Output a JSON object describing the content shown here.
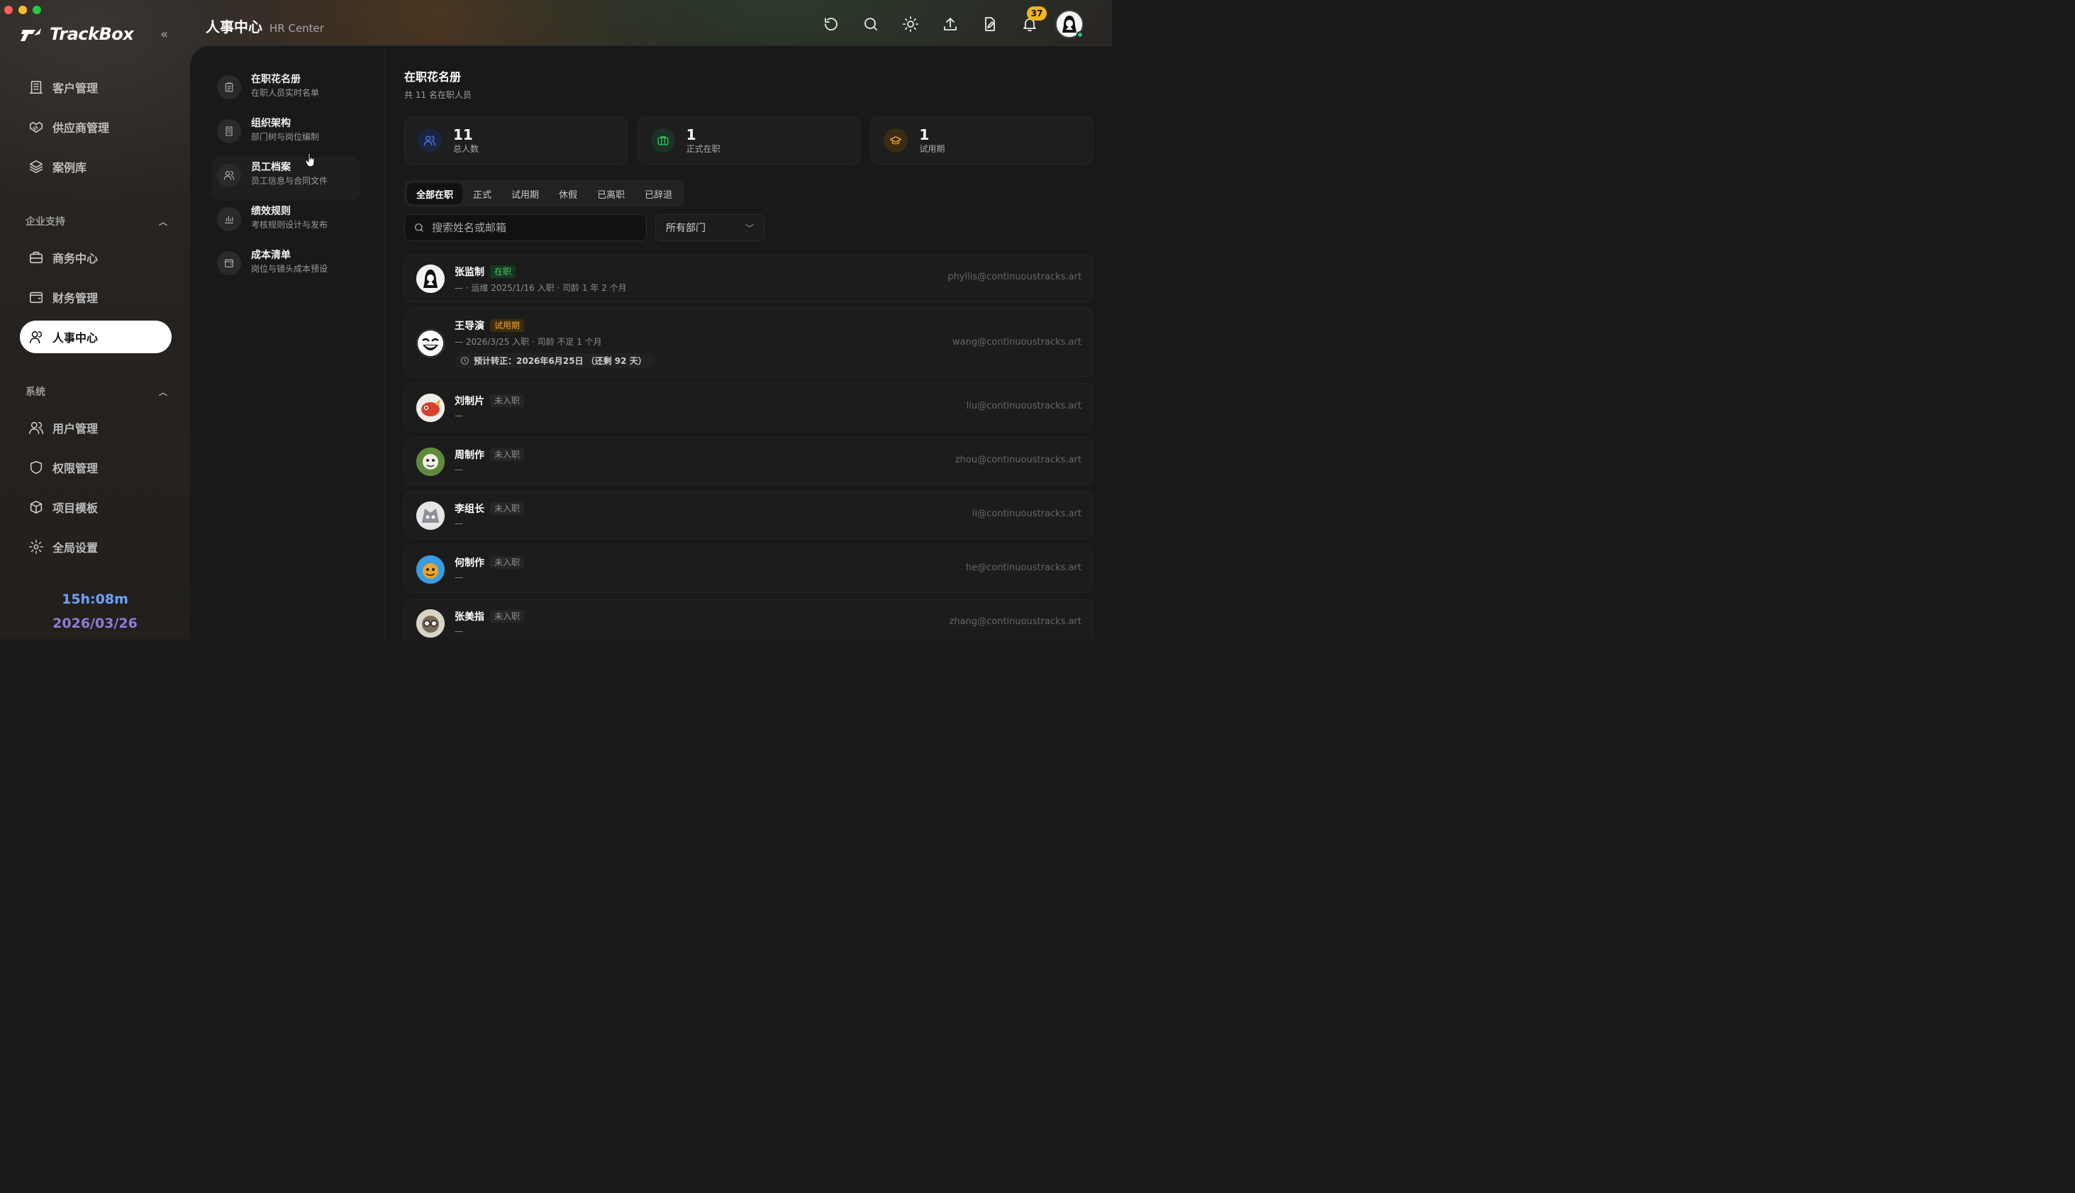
{
  "app": {
    "name": "TrackBox"
  },
  "header": {
    "title": "人事中心",
    "subtitle": "HR Center",
    "notification_count": "37",
    "icons": [
      "refresh-icon",
      "search-icon",
      "sun-icon",
      "upload-icon",
      "edit-file-icon",
      "bell-icon"
    ]
  },
  "sidebar": {
    "items_top": [
      {
        "label": "客户管理",
        "icon": "building-icon"
      },
      {
        "label": "供应商管理",
        "icon": "handshake-icon"
      },
      {
        "label": "案例库",
        "icon": "layers-icon"
      }
    ],
    "section_support": "企业支持",
    "items_support": [
      {
        "label": "商务中心",
        "icon": "briefcase-icon"
      },
      {
        "label": "财务管理",
        "icon": "wallet-icon"
      },
      {
        "label": "人事中心",
        "icon": "user-icon",
        "active": true
      }
    ],
    "section_system": "系统",
    "items_system": [
      {
        "label": "用户管理",
        "icon": "users-icon"
      },
      {
        "label": "权限管理",
        "icon": "shield-icon"
      },
      {
        "label": "项目模板",
        "icon": "cube-icon"
      },
      {
        "label": "全局设置",
        "icon": "gear-icon"
      }
    ],
    "clock": {
      "time": "15h:08m",
      "date": "2026/03/26"
    }
  },
  "subnav": [
    {
      "title": "在职花名册",
      "desc": "在职人员实时名单",
      "icon": "clipboard-icon"
    },
    {
      "title": "组织架构",
      "desc": "部门树与岗位编制",
      "icon": "building-icon"
    },
    {
      "title": "员工档案",
      "desc": "员工信息与合同文件",
      "icon": "users-icon"
    },
    {
      "title": "绩效规则",
      "desc": "考核规则设计与发布",
      "icon": "bar-chart-icon"
    },
    {
      "title": "成本清单",
      "desc": "岗位与镜头成本预设",
      "icon": "wallet-icon"
    }
  ],
  "main": {
    "title": "在职花名册",
    "subtitle": "共 11 名在职人员",
    "stats": [
      {
        "value": "11",
        "label": "总人数",
        "color": "#4f7cff"
      },
      {
        "value": "1",
        "label": "正式在职",
        "color": "#35c45e"
      },
      {
        "value": "1",
        "label": "试用期",
        "color": "#f0a73a"
      }
    ],
    "tabs": [
      "全部在职",
      "正式",
      "试用期",
      "休假",
      "已离职",
      "已辞退"
    ],
    "search_placeholder": "搜索姓名或邮箱",
    "dept_select": "所有部门",
    "people": [
      {
        "name": "张监制",
        "status": "在职",
        "status_type": "on",
        "meta": "— · 运维   2025/1/16 入职   · 司龄 1 年 2 个月",
        "email": "phyllis@continuoustracks.art"
      },
      {
        "name": "王导演",
        "status": "试用期",
        "status_type": "trial",
        "meta": "—   2026/3/25 入职   · 司龄 不足 1 个月",
        "eta": "预计转正：2026年6月25日 （还剩 92 天）",
        "email": "wang@continuoustracks.art"
      },
      {
        "name": "刘制片",
        "status": "未入职",
        "status_type": "none",
        "meta": "—",
        "email": "liu@continuoustracks.art"
      },
      {
        "name": "周制作",
        "status": "未入职",
        "status_type": "none",
        "meta": "—",
        "email": "zhou@continuoustracks.art"
      },
      {
        "name": "李组长",
        "status": "未入职",
        "status_type": "none",
        "meta": "—",
        "email": "li@continuoustracks.art"
      },
      {
        "name": "何制作",
        "status": "未入职",
        "status_type": "none",
        "meta": "—",
        "email": "he@continuoustracks.art"
      },
      {
        "name": "张美指",
        "status": "未入职",
        "status_type": "none",
        "meta": "—",
        "email": "zhang@continuoustracks.art"
      }
    ]
  }
}
